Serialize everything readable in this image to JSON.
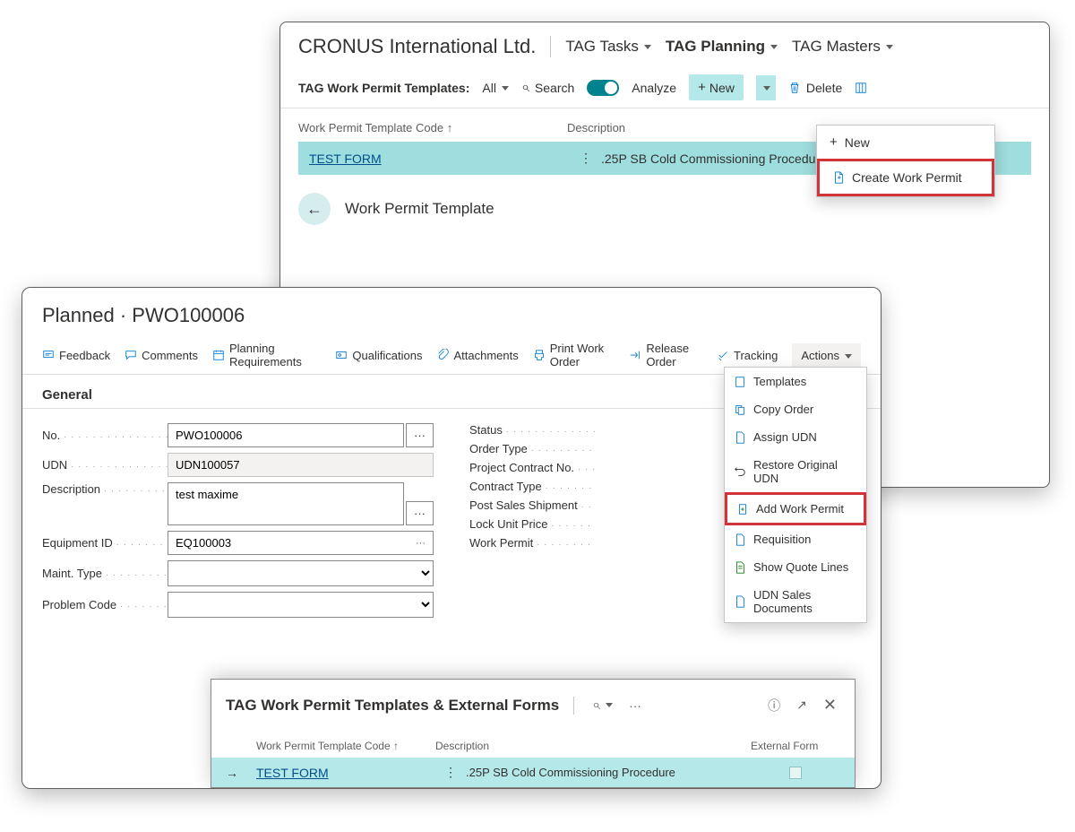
{
  "win1": {
    "company": "CRONUS International Ltd.",
    "tabs": {
      "tasks": "TAG Tasks",
      "planning": "TAG Planning",
      "masters": "TAG Masters"
    },
    "toolbar": {
      "label": "TAG Work Permit Templates:",
      "filter": "All",
      "search": "Search",
      "analyze": "Analyze",
      "new": "New",
      "delete": "Delete"
    },
    "dropdown": {
      "new": "New",
      "create": "Create Work Permit"
    },
    "columns": {
      "code": "Work Permit Template Code",
      "desc": "Description"
    },
    "row": {
      "code": "TEST FORM",
      "desc": ".25P SB Cold Commissioning Procedure"
    },
    "back_title": "Work Permit Template"
  },
  "win2": {
    "title": "Planned · PWO100006",
    "toolbar": {
      "feedback": "Feedback",
      "comments": "Comments",
      "planning": "Planning Requirements",
      "qual": "Qualifications",
      "attach": "Attachments",
      "print": "Print Work Order",
      "release": "Release Order",
      "tracking": "Tracking",
      "actions": "Actions"
    },
    "actions_menu": {
      "templates": "Templates",
      "copy": "Copy Order",
      "assign": "Assign UDN",
      "restore": "Restore Original UDN",
      "addpermit": "Add Work Permit",
      "req": "Requisition",
      "quote": "Show Quote Lines",
      "sales": "UDN Sales Documents"
    },
    "section": "General",
    "fields": {
      "no": {
        "label": "No.",
        "value": "PWO100006"
      },
      "udn": {
        "label": "UDN",
        "value": "UDN100057"
      },
      "desc": {
        "label": "Description",
        "value": "test maxime"
      },
      "equip": {
        "label": "Equipment ID",
        "value": "EQ100003"
      },
      "maint": {
        "label": "Maint. Type"
      },
      "problem": {
        "label": "Problem Code"
      },
      "status": {
        "label": "Status"
      },
      "ordertype": {
        "label": "Order Type"
      },
      "contract": {
        "label": "Project Contract No."
      },
      "ctype": {
        "label": "Contract Type"
      },
      "sales": {
        "label": "Post Sales Shipment"
      },
      "lock": {
        "label": "Lock Unit Price"
      },
      "permit": {
        "label": "Work Permit"
      }
    }
  },
  "modal": {
    "title": "TAG Work Permit Templates & External Forms",
    "columns": {
      "code": "Work Permit Template Code",
      "desc": "Description",
      "ext": "External Form"
    },
    "row": {
      "code": "TEST FORM",
      "desc": ".25P SB Cold Commissioning Procedure"
    }
  }
}
